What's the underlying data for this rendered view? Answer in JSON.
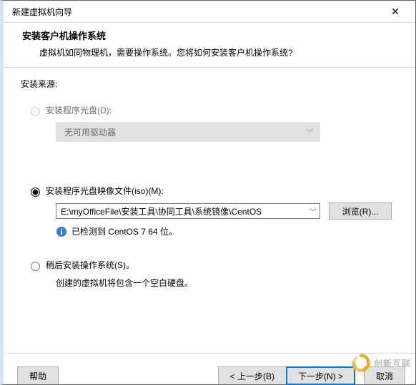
{
  "window": {
    "title": "新建虚拟机向导"
  },
  "header": {
    "title": "安装客户机操作系统",
    "desc": "虚拟机如同物理机，需要操作系统。您将如何安装客户机操作系统?"
  },
  "labels": {
    "source": "安装来源:"
  },
  "options": {
    "disc": {
      "label": "安装程序光盘(D):",
      "selected": false,
      "enabled": false,
      "dropdown_text": "无可用驱动器"
    },
    "iso": {
      "label": "安装程序光盘映像文件(iso)(M):",
      "selected": true,
      "value": "E:\\myOfficeFile\\安装工具\\协同工具\\系统镜像\\CentOS",
      "browse_label": "浏览(R)...",
      "detected_text": "已检测到 CentOS 7 64 位。"
    },
    "later": {
      "label": "稍后安装操作系统(S)。",
      "selected": false,
      "hint": "创建的虚拟机将包含一个空白硬盘。"
    }
  },
  "footer": {
    "help": "帮助",
    "back": "< 上一步(B)",
    "next": "下一步(N) >",
    "cancel": "取消"
  },
  "watermark": "创新互联",
  "icons": {
    "close": "✕",
    "info": "ℹ",
    "chev_down": "﹀"
  }
}
